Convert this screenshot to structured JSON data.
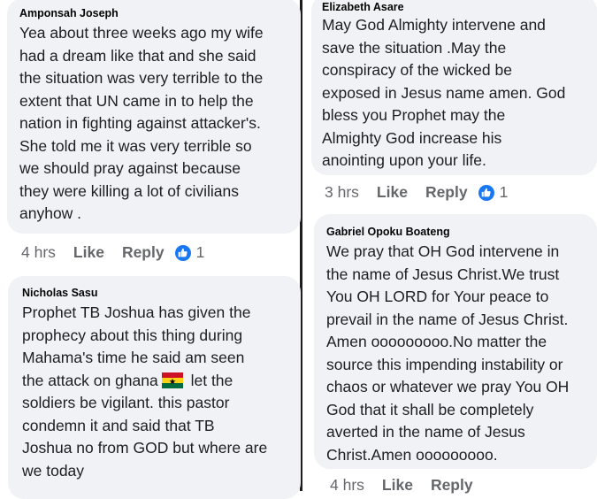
{
  "comments": [
    {
      "author": "Amponsah Joseph",
      "text": "Yea about three weeks ago my wife\nhad a dream like that and she said\nthe situation was very terrible to the\nextent that UN came in to help the\nnation in fighting against attacker's.\nShe told me it was very terrible so\nwe should pray against because\nthey were killing a lot of civilians\nanyhow .",
      "time": "4 hrs",
      "like_label": "Like",
      "reply_label": "Reply",
      "reaction_count": "1",
      "reaction_icon": "thumbs-up-icon"
    },
    {
      "author": "Nicholas Sasu",
      "text_before_flag": "Prophet TB Joshua has given  the\nprophecy about this thing during\nMahama's time   he said am seen\nthe attack on ghana",
      "flag_icon": "ghana-flag-icon",
      "text_after_flag": "  let the\nsoldiers be vigilant.   this pastor\ncondemn  it and said that TB\nJoshua no from GOD but where are\nwe today"
    },
    {
      "author": "Elizabeth Asare",
      "text": "May God Almighty intervene and\nsave the situation .May the\nconspiracy of the wicked be\nexposed in Jesus name amen. God\nbless you Prophet may the\nAlmighty God increase his\nanointing upon your life.",
      "time": "3 hrs",
      "like_label": "Like",
      "reply_label": "Reply",
      "reaction_count": "1",
      "reaction_icon": "thumbs-up-icon"
    },
    {
      "author": "Gabriel Opoku Boateng",
      "text": "We pray that OH God intervene in\nthe name of Jesus Christ.We trust\nYou OH LORD for Your peace to\nprevail in the name of Jesus Christ.\nAmen ooooooooo.No matter the\nsource this impending instability or\nchaos or whatever we pray You OH\nGod that it shall be completely\naverted in the name of Jesus\nChrist.Amen ooooooooo.",
      "time": "4 hrs",
      "like_label": "Like",
      "reply_label": "Reply"
    }
  ],
  "colors": {
    "bubble": "#f0f2f5",
    "meta_text": "#65676b",
    "reaction_blue": "#1877f2"
  }
}
